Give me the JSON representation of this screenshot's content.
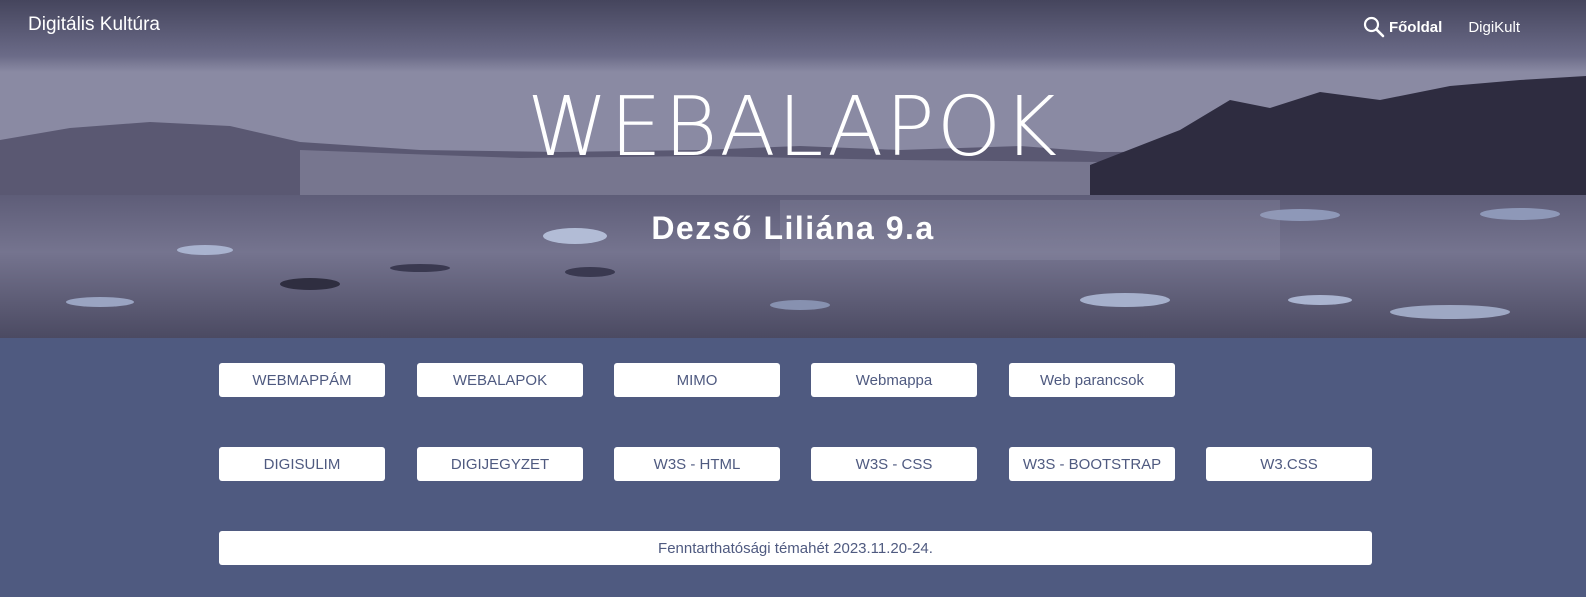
{
  "header": {
    "site_title": "Digitális Kultúra",
    "nav": [
      {
        "label": "Főoldal",
        "active": true
      },
      {
        "label": "DigiKult",
        "active": false
      }
    ],
    "search_icon": "search-icon"
  },
  "hero": {
    "title": "WEBALAPOK",
    "subtitle": "Dezső Liliána 9.a"
  },
  "buttons": {
    "row1": [
      "WEBMAPPÁM",
      "WEBALAPOK",
      "MIMO",
      "Webmappa",
      "Web parancsok"
    ],
    "row2": [
      "DIGISULIM",
      "DIGIJEGYZET",
      "W3S - HTML",
      "W3S - CSS",
      "W3S - BOOTSTRAP",
      "W3.CSS"
    ],
    "wide": "Fenntarthatósági témahét 2023.11.20-24."
  },
  "colors": {
    "page_background": "#4f5a80",
    "button_background": "#ffffff",
    "button_text": "#4f5a80"
  }
}
